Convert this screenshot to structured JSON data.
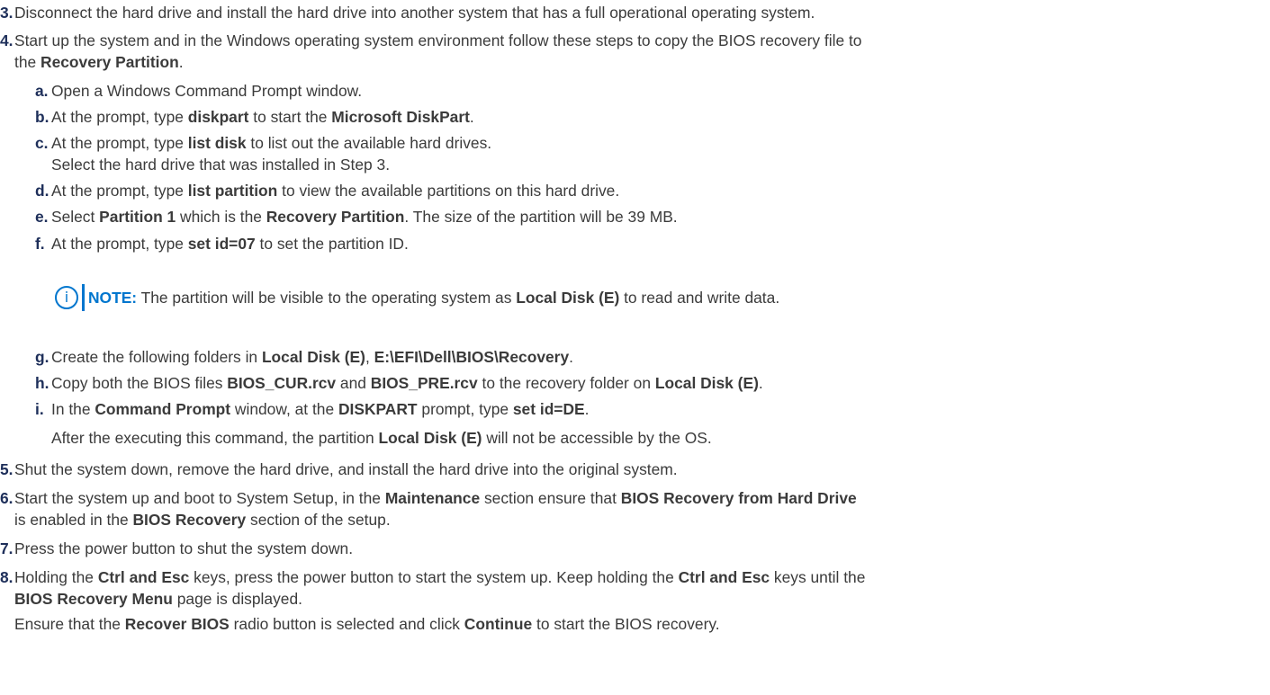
{
  "steps": {
    "s3": {
      "num": "3.",
      "text": "Disconnect the hard drive and install the hard drive into another system that has a full operational operating system."
    },
    "s4": {
      "num": "4.",
      "l1": "Start up the system and in the Windows operating system environment follow these steps to copy the BIOS recovery file to",
      "l2_pre": "the ",
      "l2_b": "Recovery Partition",
      "l2_post": ".",
      "sub": {
        "a": {
          "num": "a.",
          "text": "Open a Windows Command Prompt window."
        },
        "b": {
          "num": "b.",
          "t1": "At the prompt, type ",
          "b1": "diskpart",
          "t2": " to start the ",
          "b2": "Microsoft DiskPart",
          "t3": "."
        },
        "c": {
          "num": "c.",
          "t1": "At the prompt, type ",
          "b1": "list disk",
          "t2": " to list out the available hard drives.",
          "l2": "Select the hard drive that was installed in Step 3."
        },
        "d": {
          "num": "d.",
          "t1": "At the prompt, type ",
          "b1": "list partition",
          "t2": " to view the available partitions on this hard drive."
        },
        "e": {
          "num": "e.",
          "t1": "Select ",
          "b1": "Partition 1",
          "t2": " which is the ",
          "b2": "Recovery Partition",
          "t3": ". The size of the partition will be 39 MB."
        },
        "f": {
          "num": "f.",
          "t1": "At the prompt, type ",
          "b1": "set id=07",
          "t2": " to set the partition ID."
        },
        "note": {
          "icon": "info-icon",
          "label": "NOTE:",
          "t1": " The partition will be visible to the operating system as ",
          "b1": "Local Disk (E)",
          "t2": " to read and write data."
        },
        "g": {
          "num": "g.",
          "t1": "Create the following folders in ",
          "b1": "Local Disk (E)",
          "t2": ", ",
          "b2": "E:\\EFI\\Dell\\BIOS\\Recovery",
          "t3": "."
        },
        "h": {
          "num": "h.",
          "t1": "Copy both the BIOS files ",
          "b1": "BIOS_CUR.rcv",
          "t2": " and ",
          "b2": "BIOS_PRE.rcv",
          "t3": " to the recovery folder on ",
          "b3": "Local Disk (E)",
          "t4": "."
        },
        "i": {
          "num": "i.",
          "t1": "In the ",
          "b1": "Command Prompt",
          "t2": " window, at the ",
          "b2": "DISKPART",
          "t3": " prompt, type ",
          "b3": "set id=DE",
          "t4": ".",
          "l2a": "After the executing this command, the partition ",
          "l2b": "Local Disk (E)",
          "l2c": " will not be accessible by the OS."
        }
      }
    },
    "s5": {
      "num": "5.",
      "text": "Shut the system down, remove the hard drive, and install the hard drive into the original system."
    },
    "s6": {
      "num": "6.",
      "t1": "Start the system up and boot to System Setup, in the ",
      "b1": "Maintenance",
      "t2": " section ensure that ",
      "b2": "BIOS Recovery from Hard Drive",
      "l2a": "is enabled in the ",
      "l2b": "BIOS Recovery",
      "l2c": " section of the setup."
    },
    "s7": {
      "num": "7.",
      "text": "Press the power button to shut the system down."
    },
    "s8": {
      "num": "8.",
      "t1": "Holding the ",
      "b1": "Ctrl and Esc",
      "t2": " keys, press the power button to start the system up. Keep holding the ",
      "b2": "Ctrl and Esc",
      "t3": " keys until the",
      "l2b": "BIOS Recovery Menu",
      "l2c": " page is displayed.",
      "l3a": "Ensure that the ",
      "l3b": "Recover BIOS",
      "l3c": " radio button is selected and click ",
      "l3d": "Continue",
      "l3e": " to start the BIOS recovery."
    }
  },
  "colors": {
    "text": "#3b3b3b",
    "number": "#1e2f5a",
    "note_accent": "#0076ce"
  }
}
